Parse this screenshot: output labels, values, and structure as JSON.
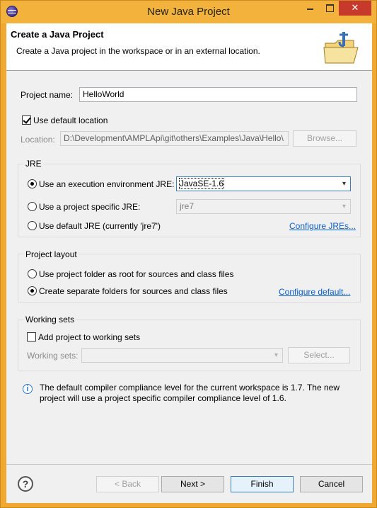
{
  "window": {
    "title": "New Java Project"
  },
  "titlebar_buttons": {
    "minimize": "",
    "maximize": "",
    "close": "✕"
  },
  "banner": {
    "title": "Create a Java Project",
    "description": "Create a Java project in the workspace or in an external location."
  },
  "project": {
    "name_label": "Project name:",
    "name_value": "HelloWorld",
    "use_default_location_label": "Use default location",
    "use_default_location_checked": true,
    "location_label": "Location:",
    "location_value": "D:\\Development\\AMPLApi\\git\\others\\Examples\\Java\\Hello\\",
    "browse_label": "Browse..."
  },
  "jre": {
    "group_title": "JRE",
    "option_exec_env": "Use an execution environment JRE:",
    "exec_env_value": "JavaSE-1.6",
    "option_project_specific": "Use a project specific JRE:",
    "project_specific_value": "jre7",
    "option_default": "Use default JRE (currently 'jre7')",
    "configure_link": "Configure JREs..."
  },
  "layout": {
    "group_title": "Project layout",
    "option_root": "Use project folder as root for sources and class files",
    "option_separate": "Create separate folders for sources and class files",
    "configure_link": "Configure default..."
  },
  "working_sets": {
    "group_title": "Working sets",
    "add_label": "Add project to working sets",
    "sets_label": "Working sets:",
    "sets_value": "",
    "select_label": "Select..."
  },
  "info": {
    "message": "The default compiler compliance level for the current workspace is 1.7. The new project will use a project specific compiler compliance level of 1.6."
  },
  "footer": {
    "back": "< Back",
    "next": "Next >",
    "finish": "Finish",
    "cancel": "Cancel",
    "help_icon": "?"
  }
}
